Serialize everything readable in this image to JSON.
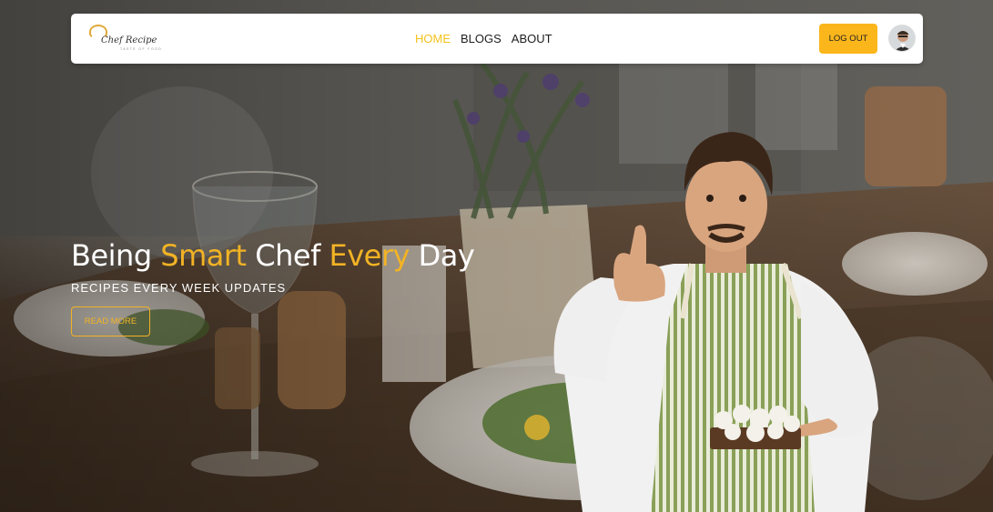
{
  "brand": {
    "name": "Chef Recipe",
    "tagline": "TASTE OF FOOD"
  },
  "nav": {
    "links": [
      {
        "label": "HOME",
        "active": true
      },
      {
        "label": "BLOGS",
        "active": false
      },
      {
        "label": "ABOUT",
        "active": false
      }
    ],
    "logout_label": "LOG OUT"
  },
  "hero": {
    "headline": {
      "w1": "Being",
      "w2": "Smart",
      "w3": "Chef",
      "w4": "Every",
      "w5": "Day"
    },
    "subheadline": "RECIPES EVERY WEEK UPDATES",
    "cta_label": "READ MORE"
  },
  "colors": {
    "accent": "#f2b325",
    "logout_bg": "#fbb61c",
    "nav_active": "#f3c21a",
    "nav_text": "#1d1d1d"
  }
}
